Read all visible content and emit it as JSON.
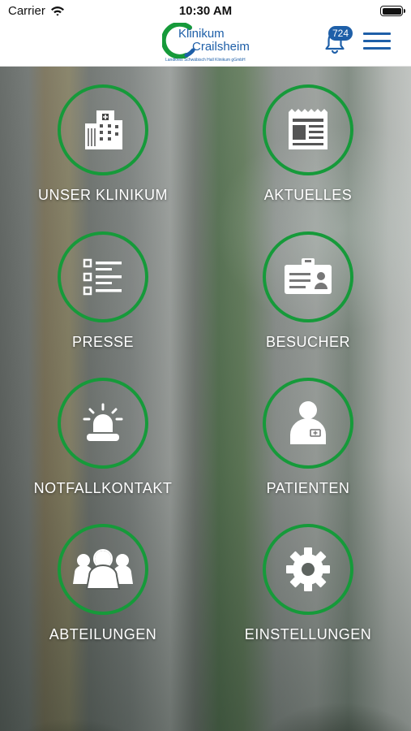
{
  "status_bar": {
    "carrier": "Carrier",
    "time": "10:30 AM"
  },
  "header": {
    "logo": {
      "line1": "Klinikum",
      "line2": "Crailsheim",
      "subtitle": "Landkreis Schwäbisch Hall Klinikum gGmbH"
    },
    "notification_count": "724",
    "icons": [
      "bell-icon",
      "hamburger-menu-icon"
    ]
  },
  "tiles": [
    {
      "label": "UNSER KLINIKUM",
      "icon": "hospital-icon"
    },
    {
      "label": "AKTUELLES",
      "icon": "newspaper-icon"
    },
    {
      "label": "PRESSE",
      "icon": "list-icon"
    },
    {
      "label": "BESUCHER",
      "icon": "visitor-badge-icon"
    },
    {
      "label": "NOTFALLKONTAKT",
      "icon": "emergency-light-icon"
    },
    {
      "label": "PATIENTEN",
      "icon": "patient-icon"
    },
    {
      "label": "ABTEILUNGEN",
      "icon": "group-icon"
    },
    {
      "label": "EINSTELLUNGEN",
      "icon": "gear-icon"
    }
  ],
  "colors": {
    "accent_green": "#169a3a",
    "brand_blue": "#1e5fa8"
  }
}
